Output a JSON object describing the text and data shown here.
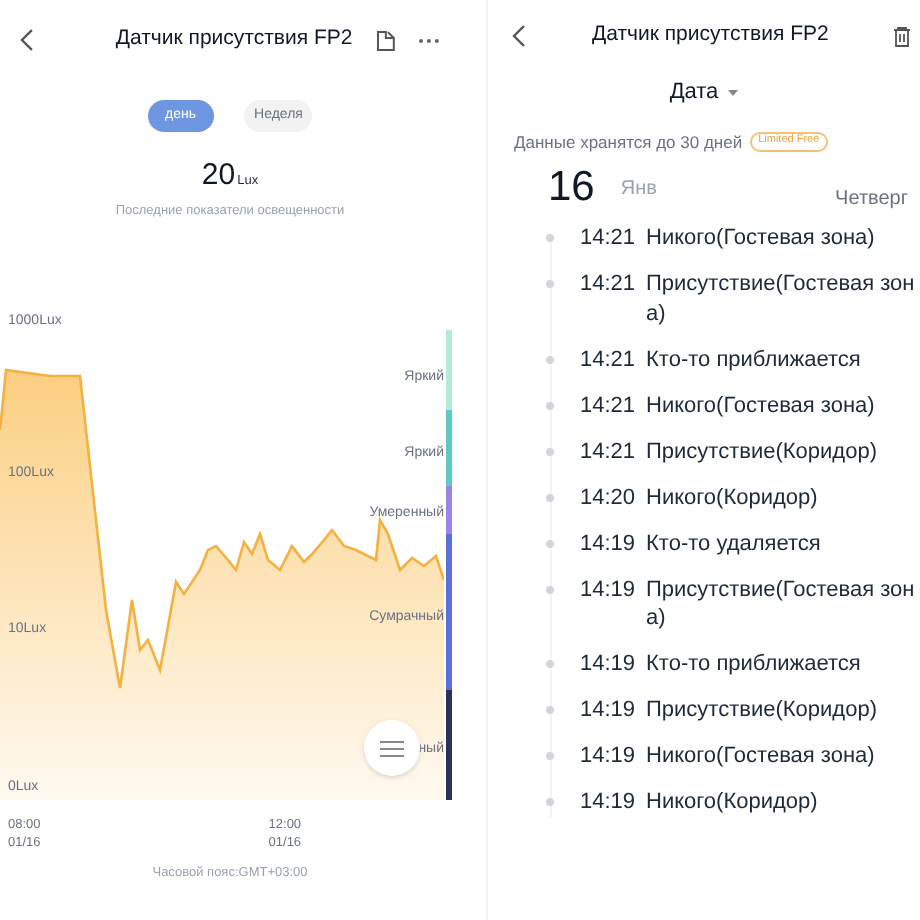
{
  "left": {
    "header": {
      "title": "Датчик присутствия FP2"
    },
    "period_tabs": [
      {
        "label": "день",
        "selected": true
      },
      {
        "label": "Неделя",
        "selected": false
      }
    ],
    "reading": {
      "value": "20",
      "unit": "Lux",
      "caption": "Последние показатели освещенности"
    },
    "chart": {
      "y_labels": [
        "1000Lux",
        "100Lux",
        "10Lux",
        "0Lux"
      ],
      "bands": [
        {
          "label": "Яркий",
          "color": "#b5ead7"
        },
        {
          "label": "Яркий",
          "color": "#5ccbc3"
        },
        {
          "label": "Умеренный",
          "color": "#9a84e6"
        },
        {
          "label": "Сумрачный",
          "color": "#5b70d6"
        },
        {
          "label": "ный",
          "color": "#2d3158"
        }
      ],
      "x_labels": [
        {
          "time": "08:00",
          "date": "01/16"
        },
        {
          "time": "12:00",
          "date": "01/16"
        }
      ],
      "timezone": "Часовой пояс:GMT+03:00"
    }
  },
  "right": {
    "header": {
      "title": "Датчик присутствия FP2"
    },
    "date_filter": {
      "label": "Дата"
    },
    "retention": {
      "text": "Данные хранятся до 30 дней",
      "badge": "Limited Free"
    },
    "day": {
      "day": "16",
      "month": "Янв",
      "weekday": "Четверг"
    },
    "events": [
      {
        "time": "14:21",
        "text": "Никого(Гостевая зона)"
      },
      {
        "time": "14:21",
        "text": "Присутствие(Гостевая зона)"
      },
      {
        "time": "14:21",
        "text": "Кто-то приближается"
      },
      {
        "time": "14:21",
        "text": "Никого(Гостевая зона)"
      },
      {
        "time": "14:21",
        "text": "Присутствие(Коридор)"
      },
      {
        "time": "14:20",
        "text": "Никого(Коридор)"
      },
      {
        "time": "14:19",
        "text": "Кто-то удаляется"
      },
      {
        "time": "14:19",
        "text": "Присутствие(Гостевая зона)"
      },
      {
        "time": "14:19",
        "text": "Кто-то приближается"
      },
      {
        "time": "14:19",
        "text": "Присутствие(Коридор)"
      },
      {
        "time": "14:19",
        "text": "Никого(Гостевая зона)"
      },
      {
        "time": "14:19",
        "text": "Никого(Коридор)"
      }
    ]
  }
}
